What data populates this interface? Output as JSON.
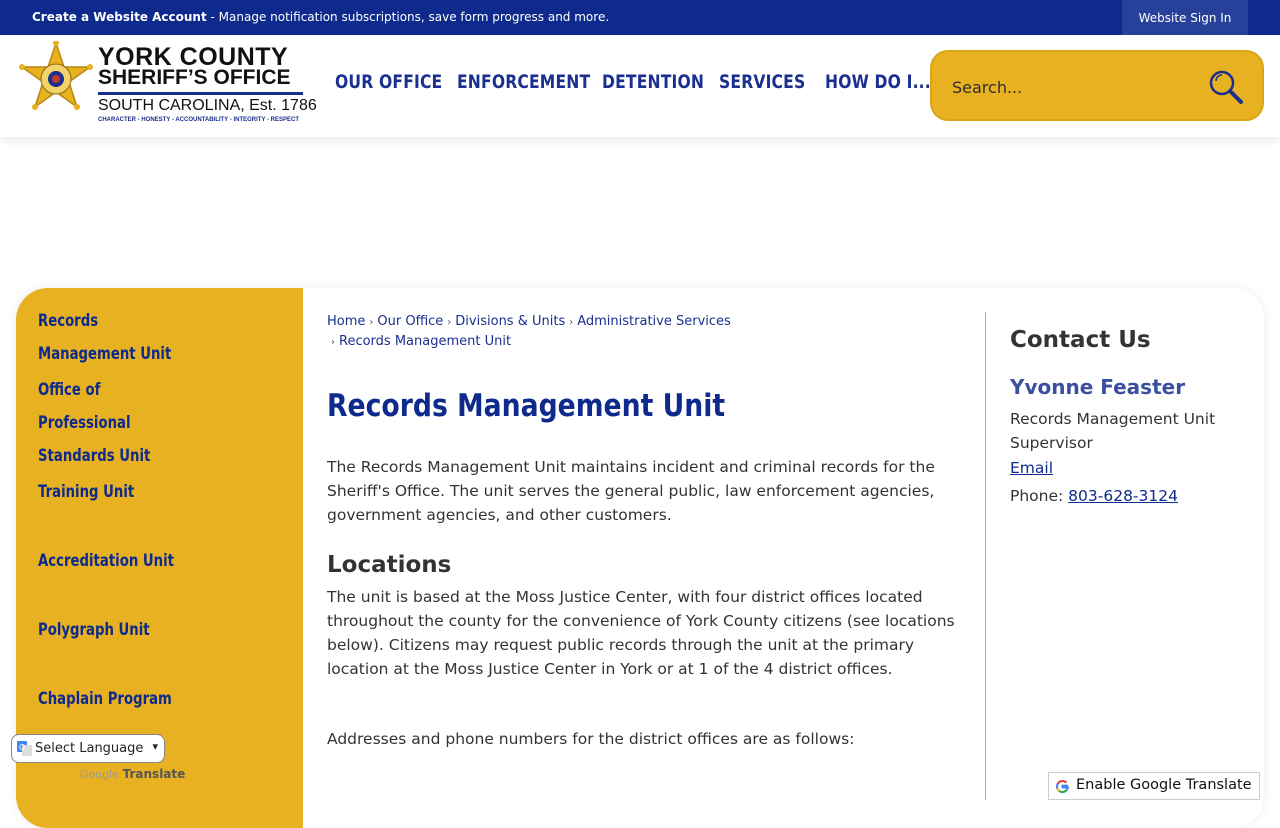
{
  "topbar": {
    "create_account": "Create a Website Account",
    "create_account_desc": " - Manage notification subscriptions, save form progress and more.",
    "sign_in": "Website Sign In"
  },
  "logo": {
    "line1": "YORK COUNTY",
    "line2": "SHERIFF’S OFFICE",
    "line3": "SOUTH CAROLINA, Est. 1786",
    "line4": "CHARACTER - HONESTY - ACCOUNTABILITY - INTEGRITY - RESPECT"
  },
  "nav": {
    "items": [
      {
        "label": "OUR OFFICE"
      },
      {
        "label": "ENFORCEMENT"
      },
      {
        "label": "DETENTION"
      },
      {
        "label": "SERVICES"
      },
      {
        "label": "HOW DO I..."
      }
    ]
  },
  "search": {
    "placeholder": "Search..."
  },
  "sidebar": {
    "items": [
      {
        "label": "Records Management Unit"
      },
      {
        "label": "Office of Professional Standards Unit"
      },
      {
        "label": "Training Unit"
      },
      {
        "label": "Accreditation Unit"
      },
      {
        "label": "Polygraph Unit"
      },
      {
        "label": "Chaplain Program"
      }
    ]
  },
  "breadcrumb": {
    "items": [
      {
        "label": "Home"
      },
      {
        "label": "Our Office"
      },
      {
        "label": "Divisions & Units"
      },
      {
        "label": "Administrative Services"
      },
      {
        "label": "Records Management Unit"
      }
    ]
  },
  "main": {
    "title": "Records Management Unit",
    "intro": "The Records Management Unit maintains incident and criminal records for the Sheriff's Office. The unit serves the general public, law enforcement agencies, government agencies, and other customers.",
    "locations_heading": "Locations",
    "locations_text": "The unit is based at the Moss Justice Center, with four district offices located throughout the county for the convenience of York County citizens (see locations below). Citizens may request public records through the unit at the primary location at the Moss Justice Center in York or at 1 of the 4 district offices.",
    "addresses_text": "Addresses and phone numbers for the district offices are as follows:"
  },
  "contact": {
    "title": "Contact Us",
    "name": "Yvonne Feaster",
    "role": "Records Management Unit Supervisor",
    "email_label": "Email",
    "phone_label": "Phone: ",
    "phone": "803-628-3124"
  },
  "translate": {
    "select_label": "Select Language",
    "powered_google": "Google",
    "powered_translate": "Translate",
    "enable_button": "Enable Google Translate"
  },
  "colors": {
    "navy": "#0e2a8c",
    "gold": "#e8b121"
  }
}
